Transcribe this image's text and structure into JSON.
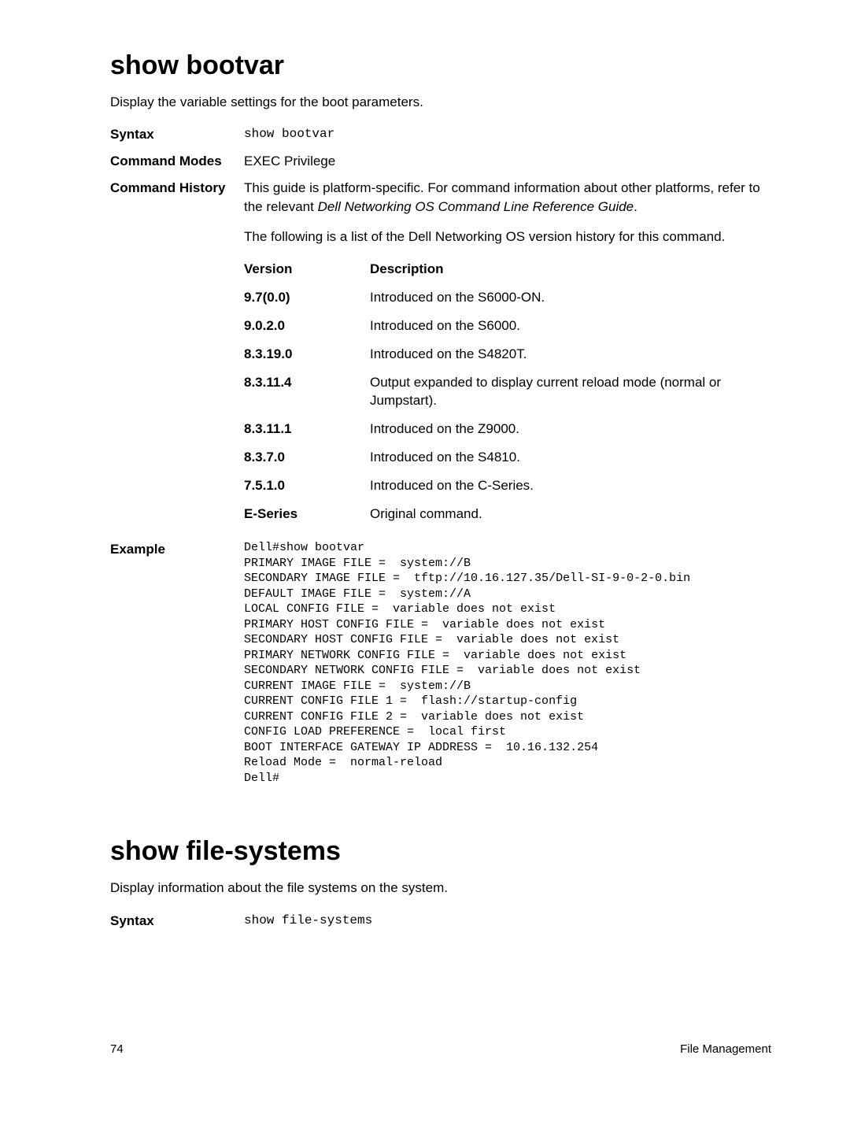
{
  "section1": {
    "title": "show bootvar",
    "subtitle": "Display the variable settings for the boot parameters.",
    "syntax_label": "Syntax",
    "syntax_value": "show bootvar",
    "modes_label": "Command Modes",
    "modes_value": "EXEC Privilege",
    "history_label": "Command History",
    "history_text_pre": "This guide is platform-specific. For command information about other platforms, refer to the relevant ",
    "history_text_italic": "Dell Networking OS Command Line Reference Guide",
    "history_text_post": ".",
    "history_note": "The following is a list of the Dell Networking OS version history for this command.",
    "version_header": "Version",
    "description_header": "Description",
    "versions": [
      {
        "v": "9.7(0.0)",
        "d": "Introduced on the S6000-ON."
      },
      {
        "v": "9.0.2.0",
        "d": "Introduced on the S6000."
      },
      {
        "v": "8.3.19.0",
        "d": "Introduced on the S4820T."
      },
      {
        "v": "8.3.11.4",
        "d": "Output expanded to display current reload mode (normal or Jumpstart)."
      },
      {
        "v": "8.3.11.1",
        "d": "Introduced on the Z9000."
      },
      {
        "v": "8.3.7.0",
        "d": "Introduced on the S4810."
      },
      {
        "v": "7.5.1.0",
        "d": "Introduced on the C-Series."
      },
      {
        "v": "E-Series",
        "d": "Original command."
      }
    ],
    "example_label": "Example",
    "example_text": "Dell#show bootvar\nPRIMARY IMAGE FILE =  system://B\nSECONDARY IMAGE FILE =  tftp://10.16.127.35/Dell-SI-9-0-2-0.bin\nDEFAULT IMAGE FILE =  system://A\nLOCAL CONFIG FILE =  variable does not exist\nPRIMARY HOST CONFIG FILE =  variable does not exist\nSECONDARY HOST CONFIG FILE =  variable does not exist\nPRIMARY NETWORK CONFIG FILE =  variable does not exist\nSECONDARY NETWORK CONFIG FILE =  variable does not exist\nCURRENT IMAGE FILE =  system://B\nCURRENT CONFIG FILE 1 =  flash://startup-config\nCURRENT CONFIG FILE 2 =  variable does not exist\nCONFIG LOAD PREFERENCE =  local first\nBOOT INTERFACE GATEWAY IP ADDRESS =  10.16.132.254\nReload Mode =  normal-reload\nDell#"
  },
  "section2": {
    "title": "show file-systems",
    "subtitle": "Display information about the file systems on the system.",
    "syntax_label": "Syntax",
    "syntax_value": "show file-systems"
  },
  "footer": {
    "page": "74",
    "section": "File Management"
  }
}
